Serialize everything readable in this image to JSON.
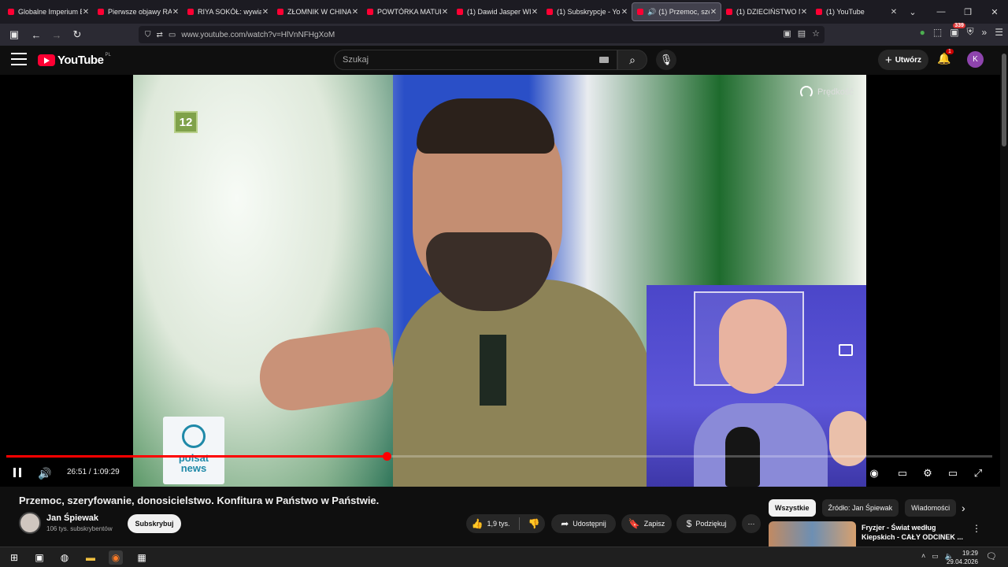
{
  "browser": {
    "tabs": [
      {
        "title": "Globalne Imperium E",
        "active": false
      },
      {
        "title": "Pierwsze objawy RAK",
        "active": false
      },
      {
        "title": "RIYA SOKÓŁ: wywiad",
        "active": false
      },
      {
        "title": "ZŁOMNIK W CHINAC",
        "active": false
      },
      {
        "title": "POWTÓRKA MATURA",
        "active": false
      },
      {
        "title": "(1) Dawid Jasper WIZ",
        "active": false
      },
      {
        "title": "(1) Subskrypcje - You",
        "active": false
      },
      {
        "title": "(1) Przemoc, szer",
        "active": true
      },
      {
        "title": "(1) DZIECIŃSTWO NA",
        "active": false
      },
      {
        "title": "(1) YouTube",
        "active": false
      }
    ],
    "url": "www.youtube.com/watch?v=HlVnNFHgXoM",
    "extension_badge": "339"
  },
  "youtube": {
    "logo_text": "YouTube",
    "logo_region": "PL",
    "search_placeholder": "Szukaj",
    "create_label": "Utwórz",
    "notification_count": "1",
    "avatar_letter": "K"
  },
  "player": {
    "channel_logo": "12",
    "watermark_line1": "polsat",
    "watermark_line2": "news",
    "speed_label": "Prędkość",
    "current_time": "26:51",
    "duration": "1:09:29",
    "time_separator": " / ",
    "progress_fraction": 0.386
  },
  "video": {
    "title": "Przemoc, szeryfowanie, donosicielstwo. Konfitura w Państwo w Państwie.",
    "channel_name": "Jan Śpiewak",
    "subscribers": "106 tys. subskrybentów",
    "subscribe_label": "Subskrybuj",
    "likes": "1,9 tys.",
    "share_label": "Udostępnij",
    "save_label": "Zapisz",
    "thanks_label": "Podziękuj"
  },
  "sidebar": {
    "chips": [
      "Wszystkie",
      "Źródło: Jan Śpiewak",
      "Wiadomości"
    ],
    "recommendation": {
      "line1": "Fryzjer - Świat według",
      "line2": "Kiepskich - CAŁY ODCINEK ..."
    }
  },
  "taskbar": {
    "time": "19:29",
    "date": "29.04.2026"
  }
}
